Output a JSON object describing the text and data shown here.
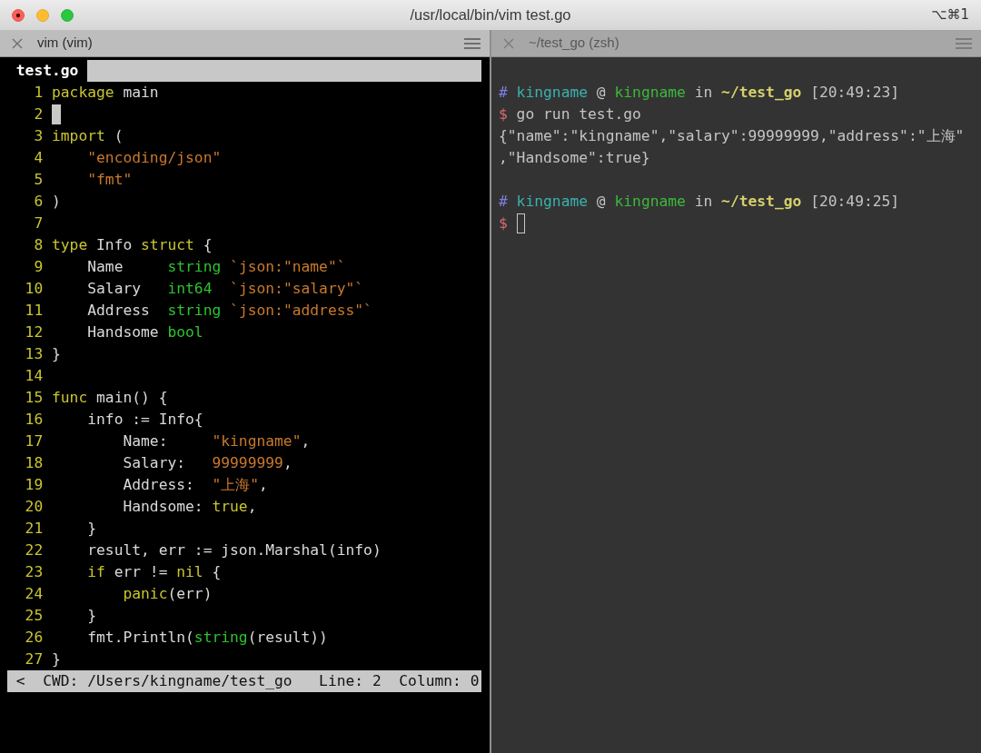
{
  "window": {
    "title": "/usr/local/bin/vim test.go",
    "shortcut": "⌥⌘1"
  },
  "panes": [
    {
      "kind": "vim",
      "title": "vim (vim)",
      "active": true,
      "editor": {
        "tab": "test.go",
        "lines": [
          {
            "number": "1",
            "tokens": [
              {
                "kind": "keyword",
                "text": "package"
              },
              {
                "kind": "plain",
                "text": " main"
              }
            ]
          },
          {
            "number": "2",
            "tokens": [
              {
                "kind": "cursor"
              }
            ]
          },
          {
            "number": "3",
            "tokens": [
              {
                "kind": "keyword",
                "text": "import"
              },
              {
                "kind": "plain",
                "text": " ("
              }
            ]
          },
          {
            "number": "4",
            "tokens": [
              {
                "kind": "string",
                "text": "    \"encoding/json\""
              }
            ]
          },
          {
            "number": "5",
            "tokens": [
              {
                "kind": "string",
                "text": "    \"fmt\""
              }
            ]
          },
          {
            "number": "6",
            "tokens": [
              {
                "kind": "plain",
                "text": ")"
              }
            ]
          },
          {
            "number": "7"
          },
          {
            "number": "8",
            "tokens": [
              {
                "kind": "keyword",
                "text": "type"
              },
              {
                "kind": "plain",
                "text": " Info "
              },
              {
                "kind": "keyword",
                "text": "struct"
              },
              {
                "kind": "plain",
                "text": " {"
              }
            ]
          },
          {
            "number": "9",
            "tokens": [
              {
                "kind": "plain",
                "text": "    Name     "
              },
              {
                "kind": "type",
                "text": "string"
              },
              {
                "kind": "string",
                "text": " `json:\"name\"`"
              }
            ]
          },
          {
            "number": "10",
            "tokens": [
              {
                "kind": "plain",
                "text": "    Salary   "
              },
              {
                "kind": "type",
                "text": "int64"
              },
              {
                "kind": "string",
                "text": "  `json:\"salary\"`"
              }
            ]
          },
          {
            "number": "11",
            "tokens": [
              {
                "kind": "plain",
                "text": "    Address  "
              },
              {
                "kind": "type",
                "text": "string"
              },
              {
                "kind": "string",
                "text": " `json:\"address\"`"
              }
            ]
          },
          {
            "number": "12",
            "tokens": [
              {
                "kind": "plain",
                "text": "    Handsome "
              },
              {
                "kind": "type",
                "text": "bool"
              }
            ]
          },
          {
            "number": "13",
            "tokens": [
              {
                "kind": "plain",
                "text": "}"
              }
            ]
          },
          {
            "number": "14"
          },
          {
            "number": "15",
            "tokens": [
              {
                "kind": "keyword",
                "text": "func"
              },
              {
                "kind": "plain",
                "text": " main() {"
              }
            ]
          },
          {
            "number": "16",
            "tokens": [
              {
                "kind": "plain",
                "text": "    info := Info{"
              }
            ]
          },
          {
            "number": "17",
            "tokens": [
              {
                "kind": "plain",
                "text": "        Name:     "
              },
              {
                "kind": "string",
                "text": "\"kingname\""
              },
              {
                "kind": "plain",
                "text": ","
              }
            ]
          },
          {
            "number": "18",
            "tokens": [
              {
                "kind": "plain",
                "text": "        Salary:   "
              },
              {
                "kind": "string",
                "text": "99999999"
              },
              {
                "kind": "plain",
                "text": ","
              }
            ]
          },
          {
            "number": "19",
            "tokens": [
              {
                "kind": "plain",
                "text": "        Address:  "
              },
              {
                "kind": "string",
                "text": "\"上海\""
              },
              {
                "kind": "plain",
                "text": ","
              }
            ]
          },
          {
            "number": "20",
            "tokens": [
              {
                "kind": "plain",
                "text": "        Handsome: "
              },
              {
                "kind": "keyword",
                "text": "true"
              },
              {
                "kind": "plain",
                "text": ","
              }
            ]
          },
          {
            "number": "21",
            "tokens": [
              {
                "kind": "plain",
                "text": "    }"
              }
            ]
          },
          {
            "number": "22",
            "tokens": [
              {
                "kind": "plain",
                "text": "    result, err := json.Marshal(info)"
              }
            ]
          },
          {
            "number": "23",
            "tokens": [
              {
                "kind": "keyword",
                "text": "    if"
              },
              {
                "kind": "plain",
                "text": " err != "
              },
              {
                "kind": "keyword",
                "text": "nil"
              },
              {
                "kind": "plain",
                "text": " {"
              }
            ]
          },
          {
            "number": "24",
            "tokens": [
              {
                "kind": "keyword",
                "text": "        panic"
              },
              {
                "kind": "plain",
                "text": "(err)"
              }
            ]
          },
          {
            "number": "25",
            "tokens": [
              {
                "kind": "plain",
                "text": "    }"
              }
            ]
          },
          {
            "number": "26",
            "tokens": [
              {
                "kind": "plain",
                "text": "    fmt.Println("
              },
              {
                "kind": "type",
                "text": "string"
              },
              {
                "kind": "plain",
                "text": "(result))"
              }
            ]
          },
          {
            "number": "27",
            "tokens": [
              {
                "kind": "plain",
                "text": "}"
              }
            ]
          }
        ],
        "status_bar": {
          "arrow": "<",
          "cwd": "CWD: /Users/kingname/test_go",
          "line": "Line: 2",
          "column": "Column: 0"
        }
      }
    },
    {
      "kind": "shell",
      "title": "~/test_go (zsh)",
      "active": false,
      "terminal": {
        "lines": [
          {
            "kind": "prompt",
            "segments": [
              {
                "kind": "hash",
                "text": "#"
              },
              {
                "kind": "user",
                "text": " kingname"
              },
              {
                "kind": "text",
                "text": " @ "
              },
              {
                "kind": "host",
                "text": "kingname"
              },
              {
                "kind": "text",
                "text": " in "
              },
              {
                "kind": "path",
                "text": "~/test_go"
              },
              {
                "kind": "text",
                "text": " [20:49:23]"
              }
            ]
          },
          {
            "kind": "command",
            "segments": [
              {
                "kind": "dollar",
                "text": "$"
              },
              {
                "kind": "text",
                "text": " go run test.go"
              }
            ]
          },
          {
            "kind": "output",
            "segments": [
              {
                "kind": "text",
                "text": "{\"name\":\"kingname\",\"salary\":99999999,\"address\":\"上海\""
              }
            ]
          },
          {
            "kind": "output",
            "segments": [
              {
                "kind": "text",
                "text": ",\"Handsome\":true}"
              }
            ]
          },
          {
            "kind": "prompt",
            "segments": [
              {
                "kind": "hash",
                "text": "#"
              },
              {
                "kind": "user",
                "text": " kingname"
              },
              {
                "kind": "text",
                "text": " @ "
              },
              {
                "kind": "host",
                "text": "kingname"
              },
              {
                "kind": "text",
                "text": " in "
              },
              {
                "kind": "path",
                "text": "~/test_go"
              },
              {
                "kind": "text",
                "text": " [20:49:25]"
              }
            ]
          },
          {
            "kind": "command",
            "segments": [
              {
                "kind": "dollar",
                "text": "$"
              },
              {
                "kind": "cursor"
              }
            ]
          }
        ]
      }
    }
  ]
}
